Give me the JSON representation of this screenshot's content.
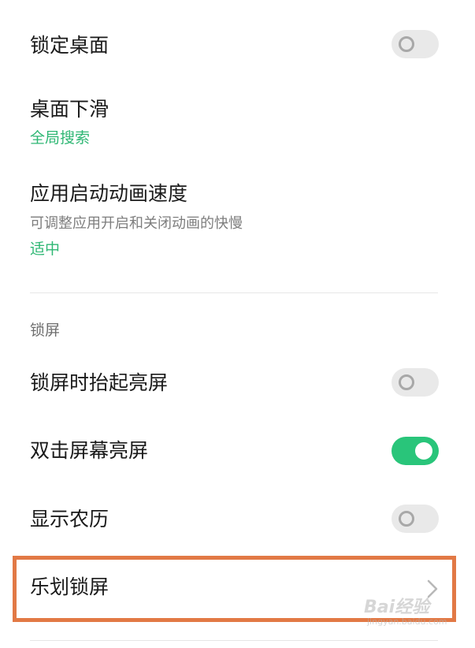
{
  "settings": {
    "lock_desktop": {
      "title": "锁定桌面",
      "enabled": false
    },
    "desktop_swipe_down": {
      "title": "桌面下滑",
      "value": "全局搜索"
    },
    "app_launch_anim": {
      "title": "应用启动动画速度",
      "description": "可调整应用开启和关闭动画的快慢",
      "value": "适中"
    }
  },
  "lockscreen_section": {
    "header": "锁屏",
    "raise_to_wake": {
      "title": "锁屏时抬起亮屏",
      "enabled": false
    },
    "double_tap_wake": {
      "title": "双击屏幕亮屏",
      "enabled": true
    },
    "show_lunar": {
      "title": "显示农历",
      "enabled": false
    },
    "lehua_lockscreen": {
      "title": "乐划锁屏"
    }
  },
  "icons": {
    "toggle_off": "toggle-off-icon",
    "toggle_on": "toggle-on-icon",
    "chevron": "chevron-right-icon"
  },
  "watermark": {
    "brand": "Bai经验",
    "url": "jingyan.baidu.com"
  },
  "colors": {
    "accent_green": "#2fb774",
    "toggle_on": "#29c57a",
    "highlight_border": "#e27945"
  }
}
